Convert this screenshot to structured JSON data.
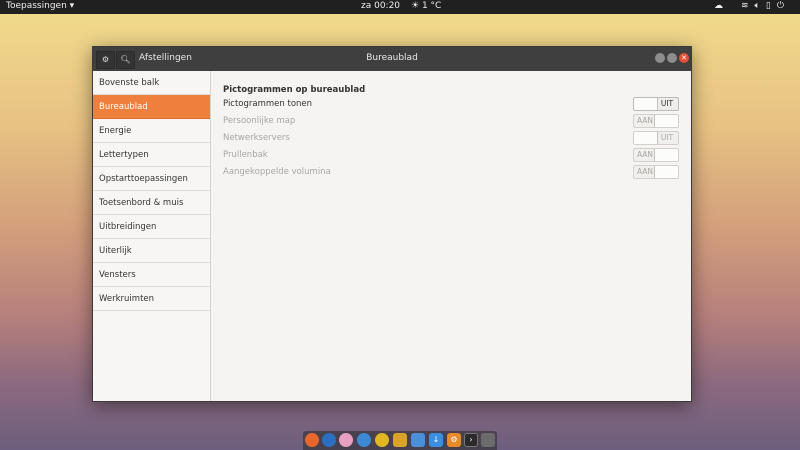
{
  "topbar": {
    "apps_label": "Toepassingen ▾",
    "clock": "za 00:20",
    "weather": "1 °C"
  },
  "window": {
    "left_title": "Afstellingen",
    "center_title": "Bureaublad"
  },
  "sidebar": {
    "items": [
      {
        "label": "Bovenste balk"
      },
      {
        "label": "Bureaublad"
      },
      {
        "label": "Energie"
      },
      {
        "label": "Lettertypen"
      },
      {
        "label": "Opstarttoepassingen"
      },
      {
        "label": "Toetsenbord & muis"
      },
      {
        "label": "Uitbreidingen"
      },
      {
        "label": "Uiterlijk"
      },
      {
        "label": "Vensters"
      },
      {
        "label": "Werkruimten"
      }
    ],
    "active_index": 1
  },
  "main": {
    "section_title": "Pictogrammen op bureaublad",
    "rows": [
      {
        "label": "Pictogrammen tonen",
        "state": "UIT",
        "enabled": true
      },
      {
        "label": "Persoonlijke map",
        "state": "AAN",
        "enabled": false
      },
      {
        "label": "Netwerkservers",
        "state": "UIT",
        "enabled": false
      },
      {
        "label": "Prullenbak",
        "state": "AAN",
        "enabled": false
      },
      {
        "label": "Aangekoppelde volumina",
        "state": "AAN",
        "enabled": false
      }
    ]
  },
  "colors": {
    "accent": "#ef7f3d",
    "titlebar": "#3f3f3f",
    "topbar": "#202020",
    "close_button": "#e2503a"
  },
  "dock": {
    "icons": [
      "firefox-icon",
      "thunderbird-icon",
      "pidgin-icon",
      "app-icon-blue",
      "app-icon-yellow",
      "puzzle-icon",
      "calculator-icon",
      "download-icon",
      "settings-icon",
      "terminal-icon",
      "photos-icon"
    ]
  },
  "tray": {
    "icons": [
      "weather-app-icon",
      "wifi-icon",
      "volume-icon",
      "battery-icon",
      "power-icon"
    ]
  }
}
